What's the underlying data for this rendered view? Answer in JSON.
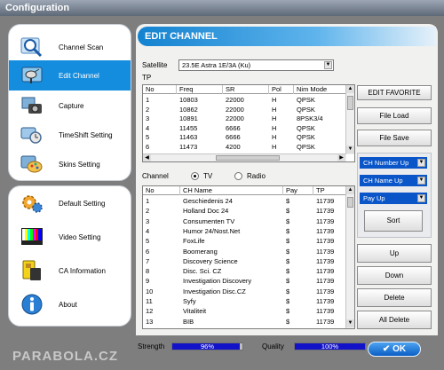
{
  "window": {
    "title": "Configuration"
  },
  "sidebar": {
    "top_items": [
      {
        "label": "Channel Scan",
        "icon": "magnifier-icon",
        "active": false
      },
      {
        "label": "Edit Channel",
        "icon": "satellite-icon",
        "active": true
      },
      {
        "label": "Capture",
        "icon": "camera-icon",
        "active": false
      },
      {
        "label": "TimeShift Setting",
        "icon": "timeshift-icon",
        "active": false
      },
      {
        "label": "Skins Setting",
        "icon": "palette-icon",
        "active": false
      }
    ],
    "bottom_items": [
      {
        "label": "Default Setting",
        "icon": "gears-icon"
      },
      {
        "label": "Video Setting",
        "icon": "color-bars-icon"
      },
      {
        "label": "CA Information",
        "icon": "card-icon"
      },
      {
        "label": "About",
        "icon": "info-icon"
      }
    ]
  },
  "main": {
    "header": "EDIT CHANNEL",
    "satellite_label": "Satellite",
    "satellite_value": "23.5E Astra 1E/3A (Ku)",
    "tp_label": "TP",
    "tp_table": {
      "columns": [
        "No",
        "Freq",
        "SR",
        "Pol",
        "Nim Mode"
      ],
      "rows": [
        [
          "1",
          "10803",
          "22000",
          "H",
          "QPSK"
        ],
        [
          "2",
          "10862",
          "22000",
          "H",
          "QPSK"
        ],
        [
          "3",
          "10891",
          "22000",
          "H",
          "8PSK3/4"
        ],
        [
          "4",
          "11455",
          "6666",
          "H",
          "QPSK"
        ],
        [
          "5",
          "11463",
          "6666",
          "H",
          "QPSK"
        ],
        [
          "6",
          "11473",
          "4200",
          "H",
          "QPSK"
        ]
      ]
    },
    "channel_label": "Channel",
    "radio_tv_label": "TV",
    "radio_radio_label": "Radio",
    "channel_table": {
      "columns": [
        "No",
        "CH Name",
        "Pay",
        "TP"
      ],
      "rows": [
        [
          "1",
          "Geschiedenis 24",
          "$",
          "11739"
        ],
        [
          "2",
          "Holland Doc 24",
          "$",
          "11739"
        ],
        [
          "3",
          "Consumenten TV",
          "$",
          "11739"
        ],
        [
          "4",
          "Humor 24/Nost.Net",
          "$",
          "11739"
        ],
        [
          "5",
          "FoxLife",
          "$",
          "11739"
        ],
        [
          "6",
          "Boomerang",
          "$",
          "11739"
        ],
        [
          "7",
          "Discovery Science",
          "$",
          "11739"
        ],
        [
          "8",
          "Disc. Sci. CZ",
          "$",
          "11739"
        ],
        [
          "9",
          "Investigation Discovery",
          "$",
          "11739"
        ],
        [
          "10",
          "Investigation Disc.CZ",
          "$",
          "11739"
        ],
        [
          "11",
          "Syfy",
          "$",
          "11739"
        ],
        [
          "12",
          "Vitaliteit",
          "$",
          "11739"
        ],
        [
          "13",
          "BIB",
          "$",
          "11739"
        ]
      ]
    }
  },
  "actions": {
    "edit_favorite": "EDIT FAVORITE",
    "file_load": "File Load",
    "file_save": "File Save",
    "sort_keys": [
      "CH Number Up",
      "CH Name Up",
      "Pay Up"
    ],
    "sort": "Sort",
    "up": "Up",
    "down": "Down",
    "delete": "Delete",
    "all_delete": "All Delete"
  },
  "status": {
    "strength_label": "Strength",
    "strength_value": "96%",
    "strength_level": 0.96,
    "quality_label": "Quality",
    "quality_value": "100%",
    "quality_level": 1.0,
    "ok_label": "✔ OK"
  },
  "watermark": "PARABOLA.CZ",
  "colors": {
    "accent": "#158dde",
    "header": "#1382d0",
    "selection": "#0a56c9",
    "meter": "#1212c8"
  }
}
